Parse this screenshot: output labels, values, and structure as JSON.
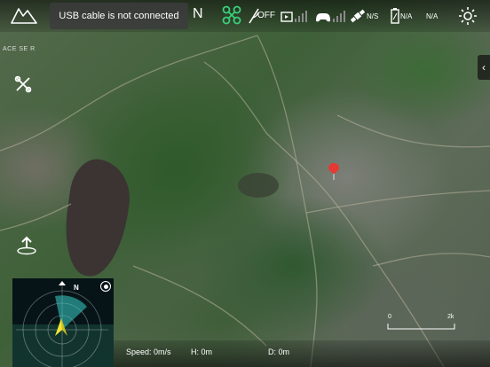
{
  "topbar": {
    "status_message": "USB cable is not connected",
    "flight_mode": "N",
    "obstacle_avoidance": "OFF",
    "gps": "N/S",
    "battery": "N/A",
    "extra": "N/A"
  },
  "map": {
    "provider_label": "ACE SE R",
    "scale_min": "0",
    "scale_max": "2k"
  },
  "radar": {
    "north_label": "N",
    "colors": {
      "sweep": "#3ad0c8",
      "aircraft": "#f2e531",
      "bottom": "#12342f"
    }
  },
  "telemetry": {
    "speed": "Speed: 0m/s",
    "height": "H: 0m",
    "distance": "D: 0m"
  },
  "colors": {
    "pin": "#e53935",
    "drone_icon": "#3ad07a"
  }
}
